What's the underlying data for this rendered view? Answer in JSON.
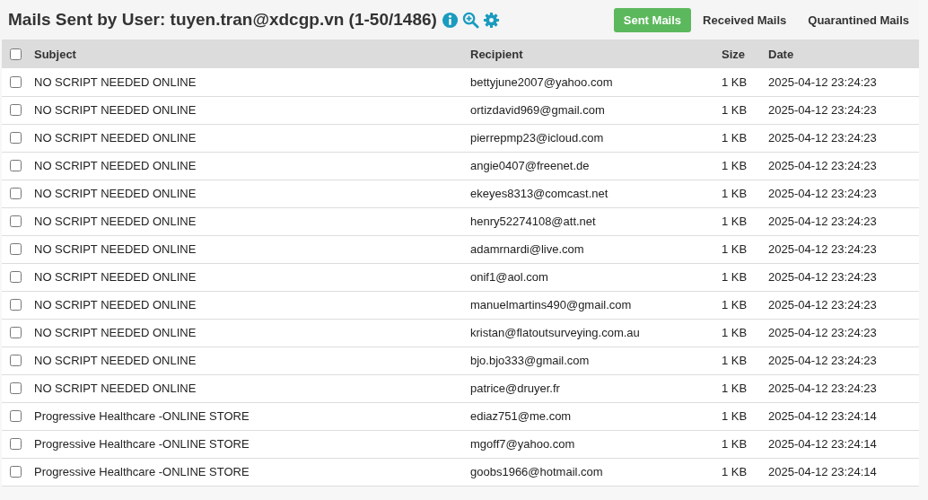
{
  "header": {
    "title": "Mails Sent by User: tuyen.tran@xdcgp.vn (1-50/1486)"
  },
  "tabs": [
    {
      "label": "Sent Mails",
      "selected": true
    },
    {
      "label": "Received Mails",
      "selected": false
    },
    {
      "label": "Quarantined Mails",
      "selected": false
    }
  ],
  "table": {
    "select_all_checked": false,
    "columns": [
      "Subject",
      "Recipient",
      "Size",
      "Date"
    ],
    "rows": [
      {
        "checked": false,
        "subject": "NO SCRIPT NEEDED ONLINE",
        "recipient": "bettyjune2007@yahoo.com",
        "size": "1 KB",
        "date": "2025-04-12 23:24:23"
      },
      {
        "checked": false,
        "subject": "NO SCRIPT NEEDED ONLINE",
        "recipient": "ortizdavid969@gmail.com",
        "size": "1 KB",
        "date": "2025-04-12 23:24:23"
      },
      {
        "checked": false,
        "subject": "NO SCRIPT NEEDED ONLINE",
        "recipient": "pierrepmp23@icloud.com",
        "size": "1 KB",
        "date": "2025-04-12 23:24:23"
      },
      {
        "checked": false,
        "subject": "NO SCRIPT NEEDED ONLINE",
        "recipient": "angie0407@freenet.de",
        "size": "1 KB",
        "date": "2025-04-12 23:24:23"
      },
      {
        "checked": false,
        "subject": "NO SCRIPT NEEDED ONLINE",
        "recipient": "ekeyes8313@comcast.net",
        "size": "1 KB",
        "date": "2025-04-12 23:24:23"
      },
      {
        "checked": false,
        "subject": "NO SCRIPT NEEDED ONLINE",
        "recipient": "henry52274108@att.net",
        "size": "1 KB",
        "date": "2025-04-12 23:24:23"
      },
      {
        "checked": false,
        "subject": "NO SCRIPT NEEDED ONLINE",
        "recipient": "adamrnardi@live.com",
        "size": "1 KB",
        "date": "2025-04-12 23:24:23"
      },
      {
        "checked": false,
        "subject": "NO SCRIPT NEEDED ONLINE",
        "recipient": "onif1@aol.com",
        "size": "1 KB",
        "date": "2025-04-12 23:24:23"
      },
      {
        "checked": false,
        "subject": "NO SCRIPT NEEDED ONLINE",
        "recipient": "manuelmartins490@gmail.com",
        "size": "1 KB",
        "date": "2025-04-12 23:24:23"
      },
      {
        "checked": false,
        "subject": "NO SCRIPT NEEDED ONLINE",
        "recipient": "kristan@flatoutsurveying.com.au",
        "size": "1 KB",
        "date": "2025-04-12 23:24:23"
      },
      {
        "checked": false,
        "subject": "NO SCRIPT NEEDED ONLINE",
        "recipient": "bjo.bjo333@gmail.com",
        "size": "1 KB",
        "date": "2025-04-12 23:24:23"
      },
      {
        "checked": false,
        "subject": "NO SCRIPT NEEDED ONLINE",
        "recipient": "patrice@druyer.fr",
        "size": "1 KB",
        "date": "2025-04-12 23:24:23"
      },
      {
        "checked": false,
        "subject": "Progressive Healthcare -ONLINE STORE",
        "recipient": "ediaz751@me.com",
        "size": "1 KB",
        "date": "2025-04-12 23:24:14"
      },
      {
        "checked": false,
        "subject": "Progressive Healthcare -ONLINE STORE",
        "recipient": "mgoff7@yahoo.com",
        "size": "1 KB",
        "date": "2025-04-12 23:24:14"
      },
      {
        "checked": false,
        "subject": "Progressive Healthcare -ONLINE STORE",
        "recipient": "goobs1966@hotmail.com",
        "size": "1 KB",
        "date": "2025-04-12 23:24:14"
      }
    ]
  }
}
